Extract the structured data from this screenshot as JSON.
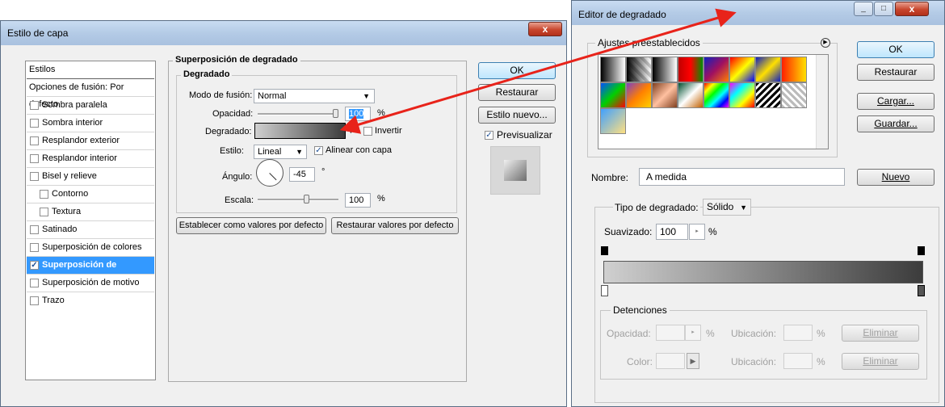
{
  "layer_style": {
    "title": "Estilo de capa",
    "close_label": "x",
    "styles_list": [
      {
        "label": "Estilos",
        "checkbox": false,
        "checked": false,
        "indent": false,
        "selected": false
      },
      {
        "label": "Opciones de fusión: Por defecto",
        "checkbox": false,
        "checked": false,
        "indent": false,
        "selected": false
      },
      {
        "label": "Sombra paralela",
        "checkbox": true,
        "checked": false,
        "indent": false,
        "selected": false
      },
      {
        "label": "Sombra interior",
        "checkbox": true,
        "checked": false,
        "indent": false,
        "selected": false
      },
      {
        "label": "Resplandor exterior",
        "checkbox": true,
        "checked": false,
        "indent": false,
        "selected": false
      },
      {
        "label": "Resplandor interior",
        "checkbox": true,
        "checked": false,
        "indent": false,
        "selected": false
      },
      {
        "label": "Bisel y relieve",
        "checkbox": true,
        "checked": false,
        "indent": false,
        "selected": false
      },
      {
        "label": "Contorno",
        "checkbox": true,
        "checked": false,
        "indent": true,
        "selected": false
      },
      {
        "label": "Textura",
        "checkbox": true,
        "checked": false,
        "indent": true,
        "selected": false
      },
      {
        "label": "Satinado",
        "checkbox": true,
        "checked": false,
        "indent": false,
        "selected": false
      },
      {
        "label": "Superposición de colores",
        "checkbox": true,
        "checked": false,
        "indent": false,
        "selected": false
      },
      {
        "label": "Superposición de degradado",
        "checkbox": true,
        "checked": true,
        "indent": false,
        "selected": true
      },
      {
        "label": "Superposición de motivo",
        "checkbox": true,
        "checked": false,
        "indent": false,
        "selected": false
      },
      {
        "label": "Trazo",
        "checkbox": true,
        "checked": false,
        "indent": false,
        "selected": false
      }
    ],
    "section_title": "Superposición de degradado",
    "group_title": "Degradado",
    "blend_mode_label": "Modo de fusión:",
    "blend_mode_value": "Normal",
    "opacity_label": "Opacidad:",
    "opacity_value": "100",
    "opacity_unit": "%",
    "gradient_label": "Degradado:",
    "invert_label": "Invertir",
    "invert_checked": false,
    "style_label": "Estilo:",
    "style_value": "Lineal",
    "align_label": "Alinear con capa",
    "align_checked": true,
    "angle_label": "Ángulo:",
    "angle_value": "-45",
    "angle_unit": "°",
    "scale_label": "Escala:",
    "scale_value": "100",
    "scale_unit": "%",
    "set_default_label": "Establecer como valores por defecto",
    "reset_default_label": "Restaurar valores por defecto",
    "ok_label": "OK",
    "restore_label": "Restaurar",
    "new_style_label": "Estilo nuevo...",
    "preview_label": "Previsualizar",
    "preview_checked": true
  },
  "gradient_editor": {
    "title": "Editor de degradado",
    "minimize_label": "_",
    "maximize_label": "□",
    "close_label": "x",
    "presets_title": "Ajustes preestablecidos",
    "presets_menu_icon": "circle-arrow-icon",
    "ok_label": "OK",
    "restore_label": "Restaurar",
    "load_label": "Cargar...",
    "save_label": "Guardar...",
    "name_label": "Nombre:",
    "name_value": "A medida",
    "new_label": "Nuevo",
    "type_label": "Tipo de degradado:",
    "type_value": "Sólido",
    "smoothness_label": "Suavizado:",
    "smoothness_value": "100",
    "smoothness_unit": "%",
    "stops_title": "Detenciones",
    "opacity_label": "Opacidad:",
    "opacity_unit": "%",
    "location_label": "Ubicación:",
    "location_unit": "%",
    "delete_label": "Eliminar",
    "color_label": "Color:",
    "location_label_2": "Ubicación:",
    "location_unit_2": "%",
    "delete_label_2": "Eliminar"
  },
  "colors": {
    "arrow": "#e8231a",
    "selection": "#3399ff",
    "gradient_from": "#d0d0d0",
    "gradient_to": "#3c3c3c"
  }
}
